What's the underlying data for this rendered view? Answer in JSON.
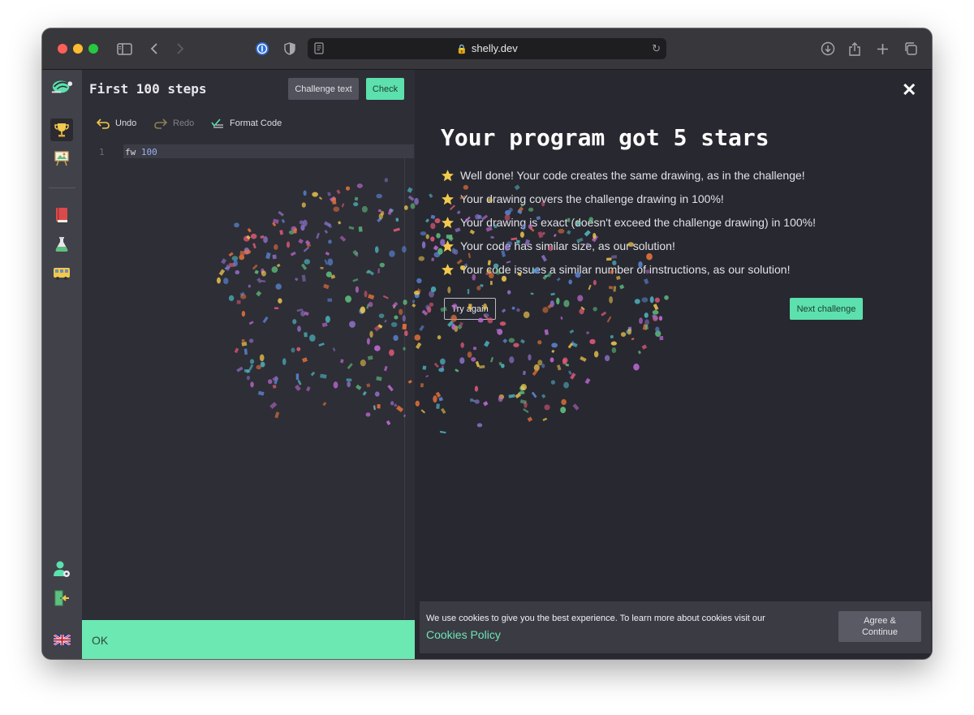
{
  "browser": {
    "url": "shelly.dev",
    "icons": [
      "sidebar-icon",
      "back-icon",
      "forward-icon",
      "password-manager-icon",
      "privacy-shield-icon",
      "reader-icon",
      "lock-icon",
      "reload-icon",
      "download-icon",
      "share-icon",
      "new-tab-icon",
      "tab-overview-icon"
    ]
  },
  "sidebar": {
    "items": [
      {
        "name": "trophy-icon",
        "active": true
      },
      {
        "name": "easel-icon",
        "active": false
      },
      {
        "name": "book-icon",
        "active": false
      },
      {
        "name": "flask-icon",
        "active": false
      },
      {
        "name": "bus-icon",
        "active": false
      },
      {
        "name": "user-settings-icon",
        "active": false
      },
      {
        "name": "logout-icon",
        "active": false
      },
      {
        "name": "uk-flag-icon",
        "active": false
      }
    ]
  },
  "editor": {
    "title": "First 100 steps",
    "challenge_text_label": "Challenge text",
    "check_label": "Check",
    "undo_label": "Undo",
    "redo_label": "Redo",
    "format_label": "Format Code",
    "line_number": "1",
    "code_keyword": "fw",
    "code_value": "100",
    "status": "OK"
  },
  "result": {
    "title": "Your program got 5 stars",
    "stars": [
      "Well done! Your code creates the same drawing, as in the challenge!",
      "Your drawing covers the challenge drawing in 100%!",
      "Your drawing is exact (doesn't exceed the challenge drawing) in 100%!",
      "Your code has similar size, as our solution!",
      "Your code issues a similar number of instructions, as our solution!"
    ],
    "try_again_label": "Try again",
    "next_label": "Next challenge"
  },
  "cookie": {
    "text": "We use cookies to give you the best experience. To learn more about cookies visit our ",
    "link": "Cookies Policy",
    "agree_label": "Agree &\nContinue"
  },
  "colors": {
    "accent": "#5ce0ad",
    "star": "#f2c94c",
    "confetti": [
      "#8e72c9",
      "#5a86d6",
      "#e8743b",
      "#f2c94c",
      "#5fbf7f",
      "#e05a78",
      "#4db6c2",
      "#c26bd6"
    ]
  }
}
